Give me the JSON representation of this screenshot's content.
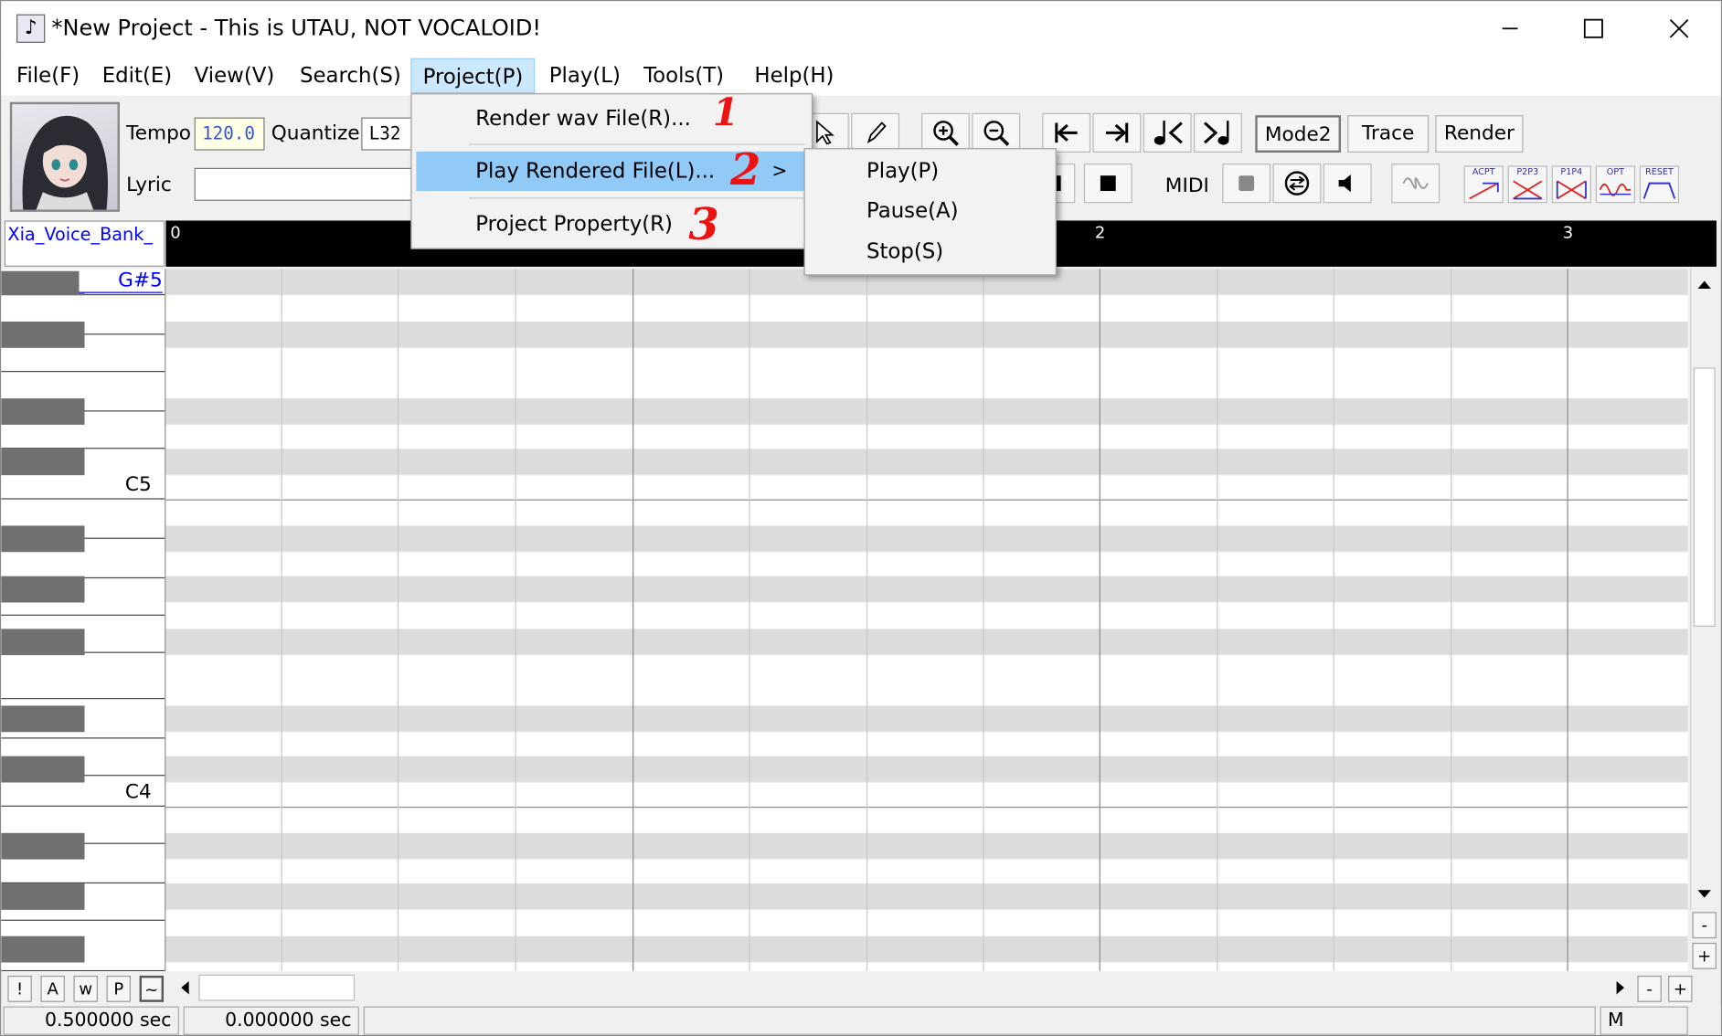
{
  "window": {
    "title": "*New Project - This is UTAU, NOT VOCALOID!",
    "app_icon": "♪"
  },
  "menubar": {
    "items": [
      "File(F)",
      "Edit(E)",
      "View(V)",
      "Search(S)",
      "Project(P)",
      "Play(L)",
      "Tools(T)",
      "Help(H)"
    ],
    "active_index": 4
  },
  "toolbar": {
    "tempo_label": "Tempo",
    "tempo_value": "120.0",
    "quantize_label": "Quantize",
    "quantize_value": "L32",
    "lyric_label": "Lyric",
    "lyric_value": "",
    "mode_label": "Mode2",
    "trace_label": "Trace",
    "render_label": "Render",
    "midi_label": "MIDI",
    "effect_labels": [
      "ACPT",
      "P2P3",
      "P1P4",
      "OPT",
      "RESET"
    ]
  },
  "ruler": {
    "voicebank": "Xia_Voice_Bank_",
    "measures": [
      "0",
      "2",
      "3"
    ]
  },
  "piano": {
    "labels": [
      "G#5",
      "C5",
      "C4"
    ]
  },
  "project_menu": {
    "items": [
      "Render wav File(R)...",
      "Play Rendered File(L)...",
      "Project Property(R)"
    ],
    "highlight_index": 1,
    "submenu_arrow": ">"
  },
  "submenu": {
    "items": [
      "Play(P)",
      "Pause(A)",
      "Stop(S)"
    ]
  },
  "annotations": [
    "1",
    "2",
    "3"
  ],
  "bottom_buttons": [
    "!",
    "A",
    "w",
    "P",
    "~"
  ],
  "zoom_buttons": {
    "minus": "-",
    "plus": "+"
  },
  "status": {
    "time1": "0.500000 sec",
    "time2": "0.000000 sec",
    "mode": "M"
  },
  "colors": {
    "menu_highlight": "#91c9f7",
    "annotation": "#e11111",
    "ruler_bg": "#000000",
    "voicebank_text": "#0000ff"
  }
}
